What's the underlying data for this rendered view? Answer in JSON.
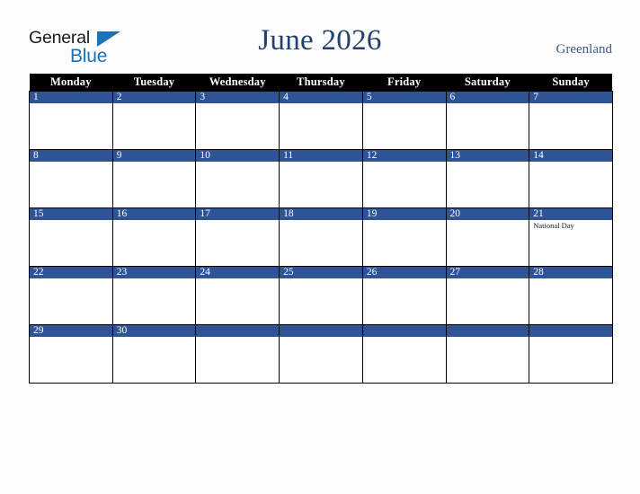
{
  "logo": {
    "word_general": "General",
    "word_blue": "Blue",
    "triangle_color": "#1d71b8"
  },
  "header": {
    "title": "June 2026",
    "country": "Greenland",
    "title_color": "#24406e",
    "country_color": "#3d5a86"
  },
  "calendar": {
    "weekday_headers": [
      "Monday",
      "Tuesday",
      "Wednesday",
      "Thursday",
      "Friday",
      "Saturday",
      "Sunday"
    ],
    "header_bg": "#000000",
    "daynum_band_color": "#2f5496",
    "weeks": [
      [
        {
          "day": "1",
          "events": []
        },
        {
          "day": "2",
          "events": []
        },
        {
          "day": "3",
          "events": []
        },
        {
          "day": "4",
          "events": []
        },
        {
          "day": "5",
          "events": []
        },
        {
          "day": "6",
          "events": []
        },
        {
          "day": "7",
          "events": []
        }
      ],
      [
        {
          "day": "8",
          "events": []
        },
        {
          "day": "9",
          "events": []
        },
        {
          "day": "10",
          "events": []
        },
        {
          "day": "11",
          "events": []
        },
        {
          "day": "12",
          "events": []
        },
        {
          "day": "13",
          "events": []
        },
        {
          "day": "14",
          "events": []
        }
      ],
      [
        {
          "day": "15",
          "events": []
        },
        {
          "day": "16",
          "events": []
        },
        {
          "day": "17",
          "events": []
        },
        {
          "day": "18",
          "events": []
        },
        {
          "day": "19",
          "events": []
        },
        {
          "day": "20",
          "events": []
        },
        {
          "day": "21",
          "events": [
            "National Day"
          ]
        }
      ],
      [
        {
          "day": "22",
          "events": []
        },
        {
          "day": "23",
          "events": []
        },
        {
          "day": "24",
          "events": []
        },
        {
          "day": "25",
          "events": []
        },
        {
          "day": "26",
          "events": []
        },
        {
          "day": "27",
          "events": []
        },
        {
          "day": "28",
          "events": []
        }
      ],
      [
        {
          "day": "29",
          "events": []
        },
        {
          "day": "30",
          "events": []
        },
        {
          "day": "",
          "events": []
        },
        {
          "day": "",
          "events": []
        },
        {
          "day": "",
          "events": []
        },
        {
          "day": "",
          "events": []
        },
        {
          "day": "",
          "events": []
        }
      ]
    ]
  }
}
